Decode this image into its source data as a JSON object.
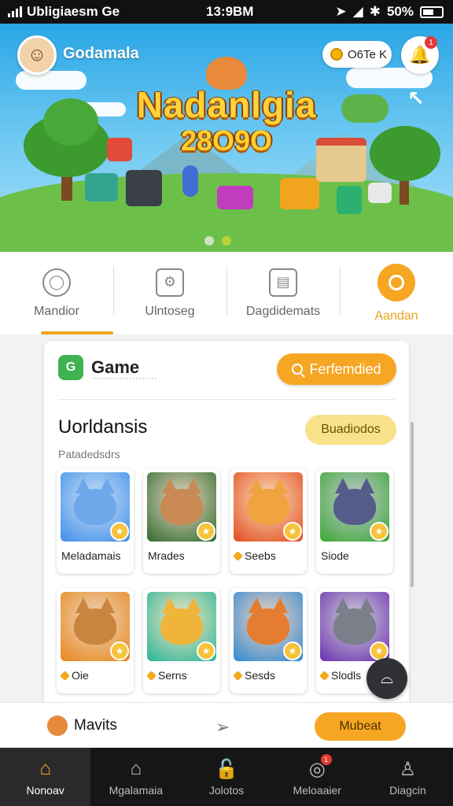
{
  "status_bar": {
    "carrier": "Ubligiaesm Ge",
    "time": "13:9BM",
    "battery": "50%"
  },
  "header": {
    "username": "Godamala",
    "coins": "O6Te K",
    "notification_count": "1"
  },
  "hero": {
    "title": "Nadanlgia",
    "score": "28O9O"
  },
  "nav": {
    "items": [
      {
        "label": "Mandior"
      },
      {
        "label": "Ulntoseg"
      },
      {
        "label": "Dagdidemats"
      },
      {
        "label": "Aandan"
      }
    ]
  },
  "card": {
    "title": "Game",
    "subtitle": "·····················",
    "action_label": "Ferfemdied",
    "section_title": "Uorldansis",
    "section_button": "Buadiodos",
    "section_subtitle": "Patadedsdrs",
    "tiles": [
      {
        "label": "Meladamais",
        "gem": false,
        "bg": "#3d8ee8",
        "face": "#6fa8ea"
      },
      {
        "label": "Mrades",
        "gem": false,
        "bg": "#2e6b2c",
        "face": "#c98a56"
      },
      {
        "label": "Seebs",
        "gem": true,
        "bg": "#e24b1c",
        "face": "#f0a340"
      },
      {
        "label": "Siode",
        "gem": false,
        "bg": "#3aa830",
        "face": "#565c8a"
      },
      {
        "label": "Oie",
        "gem": true,
        "bg": "#e8861c",
        "face": "#c98540"
      },
      {
        "label": "Serns",
        "gem": true,
        "bg": "#27b59c",
        "face": "#f0b43a"
      },
      {
        "label": "Sesds",
        "gem": true,
        "bg": "#2e8ad6",
        "face": "#e57c30"
      },
      {
        "label": "Slodls",
        "gem": true,
        "bg": "#6a2fb0",
        "face": "#7a7f8a"
      }
    ]
  },
  "action_bar": {
    "label": "Mavits",
    "button": "Mubeat"
  },
  "tabs": [
    {
      "label": "Nonoav",
      "icon": "home-icon"
    },
    {
      "label": "Mgalamaia",
      "icon": "building-icon"
    },
    {
      "label": "Jolotos",
      "icon": "lock-icon"
    },
    {
      "label": "Meloaaier",
      "icon": "chat-bubble-icon",
      "badge": "1"
    },
    {
      "label": "Diagcin",
      "icon": "person-icon"
    }
  ]
}
